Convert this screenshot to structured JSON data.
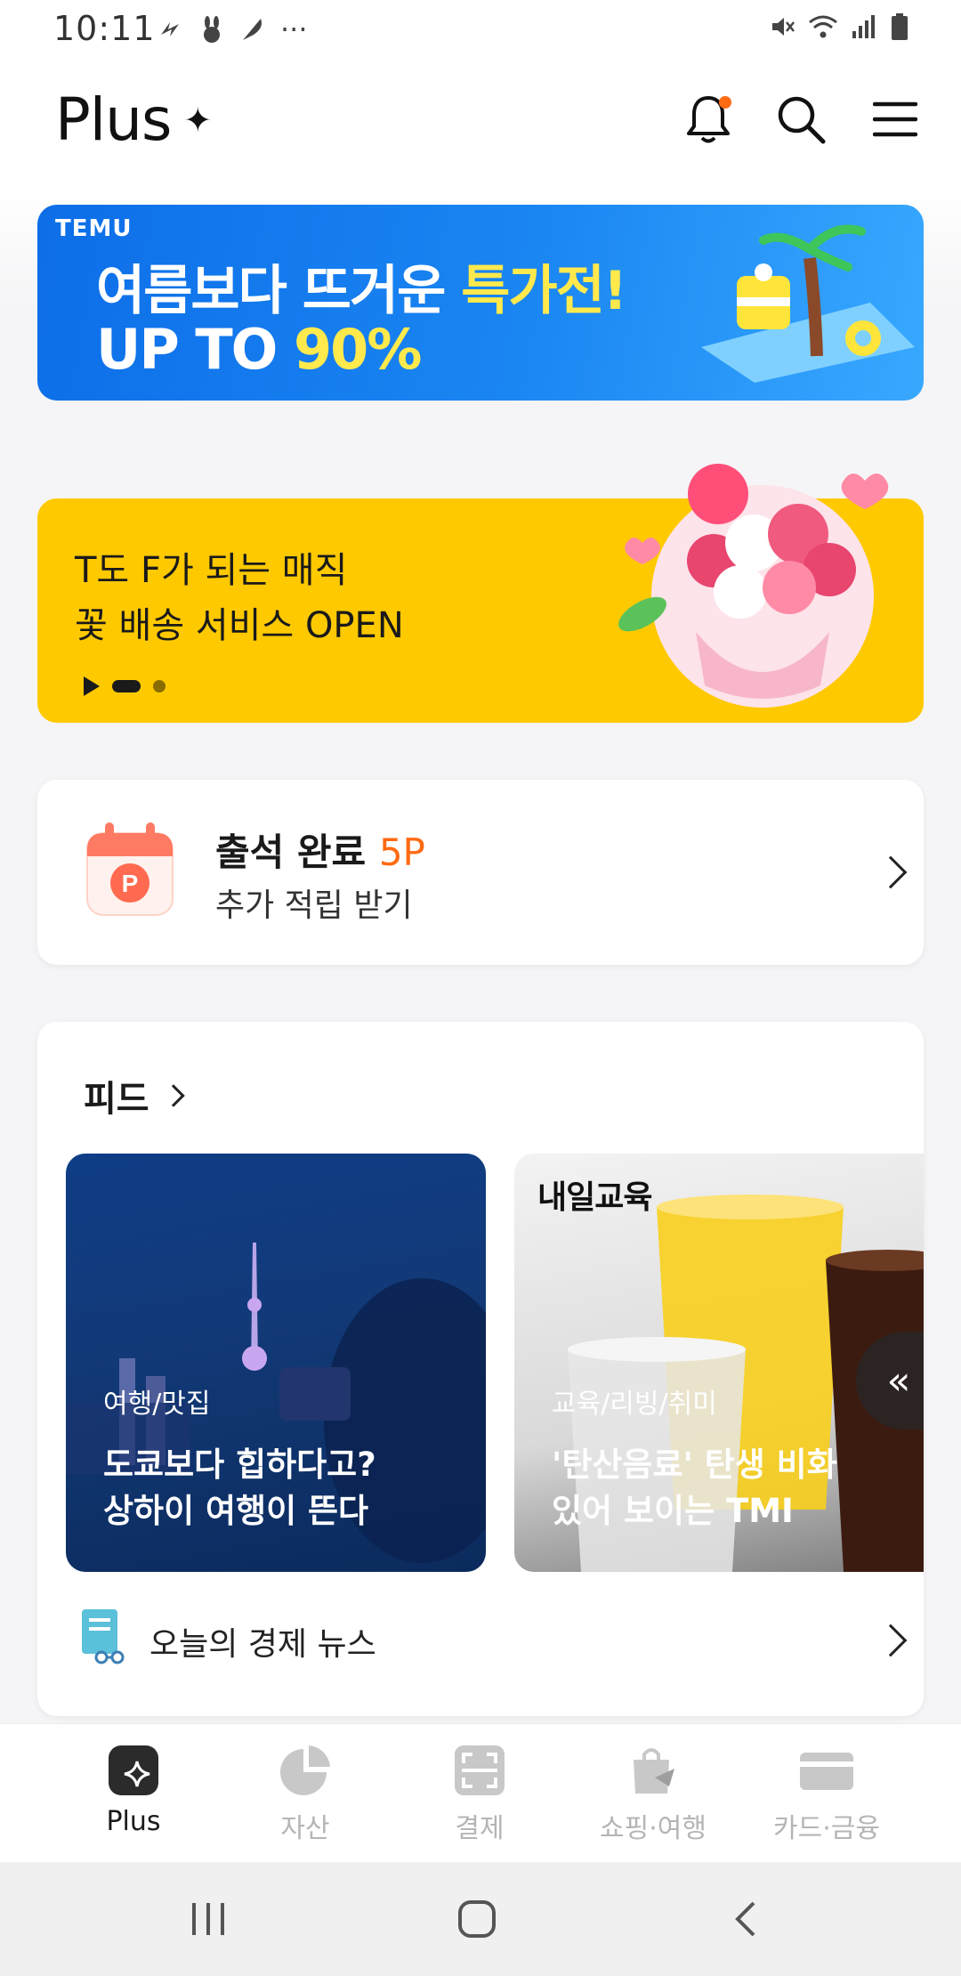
{
  "status_bar": {
    "time": "10:11",
    "left_icons": [
      "s-app-icon",
      "rabbit-icon",
      "feather-icon",
      "more-dots-icon"
    ],
    "more": "···",
    "right_icons": [
      "mute-icon",
      "wifi-icon",
      "signal-icon",
      "battery-icon"
    ]
  },
  "header": {
    "title": "Plus",
    "sparkle": "✦"
  },
  "temu_banner": {
    "brand": "TEMU",
    "line1_a": "여름보다 뜨거운 ",
    "line1_b": "특가전!",
    "line2_a": "UP TO ",
    "line2_b": "90%"
  },
  "flower_banner": {
    "line1": "T도 F가 되는 매직",
    "line2": "꽃 배송 서비스 OPEN"
  },
  "attendance": {
    "title": "출석 완료 ",
    "points": "5P",
    "subtitle": "추가 적립 받기",
    "icon_letter": "P"
  },
  "feed": {
    "title": "피드",
    "items": [
      {
        "category": "여행/맛집",
        "headline_1": "도쿄보다 힙하다고?",
        "headline_2": "상하이 여행이 뜬다"
      },
      {
        "brand": "내일교육",
        "category": "교육/리빙/취미",
        "headline_1": "'탄산음료' 탄생 비화",
        "headline_2": "있어 보이는 TMI"
      }
    ],
    "collapse_glyph": "«",
    "news_label": "오늘의 경제 뉴스"
  },
  "bottom_nav": {
    "items": [
      {
        "label": "Plus",
        "icon": "plus-sparkle-icon",
        "active": true
      },
      {
        "label": "자산",
        "icon": "pie-chart-icon",
        "active": false
      },
      {
        "label": "결제",
        "icon": "scan-icon",
        "active": false
      },
      {
        "label": "쇼핑·여행",
        "icon": "shopping-bag-icon",
        "active": false
      },
      {
        "label": "카드·금융",
        "icon": "card-icon",
        "active": false
      }
    ]
  },
  "colors": {
    "accent_orange": "#ff6a13",
    "banner_yellow": "#ffc900",
    "temu_blue": "#1a86f2",
    "highlight_yellow": "#ffe94d"
  }
}
